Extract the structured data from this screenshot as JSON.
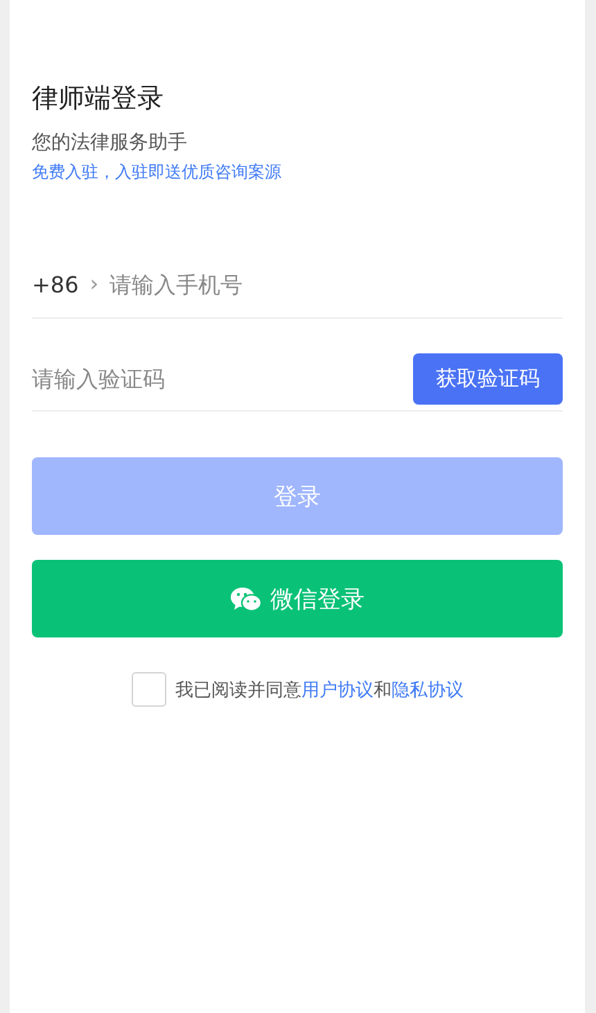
{
  "header": {
    "title": "律师端登录",
    "subtitle": "您的法律服务助手",
    "promo": "免费入驻，入驻即送优质咨询案源"
  },
  "phone": {
    "country_code": "+86",
    "chevron": "›",
    "placeholder": "请输入手机号"
  },
  "code": {
    "placeholder": "请输入验证码",
    "button": "获取验证码"
  },
  "login_button": {
    "label": "登录",
    "disabled": true
  },
  "wechat_button": {
    "label": "微信登录"
  },
  "agreement": {
    "checked": false,
    "text_before": "我已阅读并同意",
    "link_1": "用户协议",
    "text_middle": "和",
    "link_2": "隐私协议"
  }
}
